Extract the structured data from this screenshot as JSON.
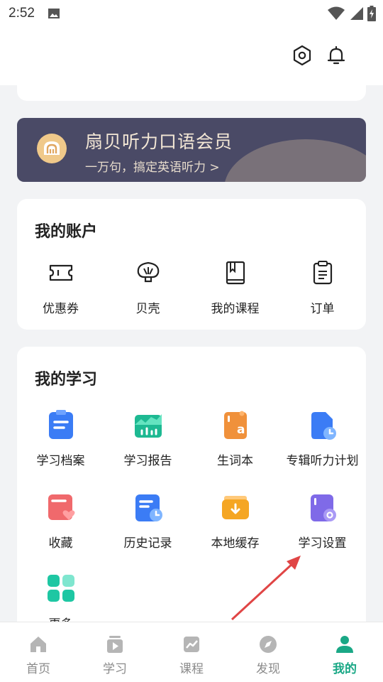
{
  "status_bar": {
    "time": "2:52"
  },
  "banner": {
    "title": "扇贝听力口语会员",
    "subtitle": "一万句，搞定英语听力 >"
  },
  "account": {
    "title": "我的账户",
    "items": [
      {
        "label": "优惠券",
        "icon": "coupon-icon"
      },
      {
        "label": "贝壳",
        "icon": "shell-icon"
      },
      {
        "label": "我的课程",
        "icon": "book-icon"
      },
      {
        "label": "订单",
        "icon": "order-icon"
      }
    ]
  },
  "study": {
    "title": "我的学习",
    "items": [
      {
        "label": "学习档案",
        "icon": "archive-icon"
      },
      {
        "label": "学习报告",
        "icon": "report-icon"
      },
      {
        "label": "生词本",
        "icon": "vocabulary-icon"
      },
      {
        "label": "专辑听力计划",
        "icon": "album-plan-icon"
      },
      {
        "label": "收藏",
        "icon": "favorites-icon"
      },
      {
        "label": "历史记录",
        "icon": "history-icon"
      },
      {
        "label": "本地缓存",
        "icon": "cache-icon"
      },
      {
        "label": "学习设置",
        "icon": "study-settings-icon"
      },
      {
        "label": "更多",
        "icon": "more-icon"
      }
    ]
  },
  "tabs": [
    {
      "label": "首页",
      "icon": "home-icon"
    },
    {
      "label": "学习",
      "icon": "play-icon"
    },
    {
      "label": "课程",
      "icon": "course-icon"
    },
    {
      "label": "发现",
      "icon": "compass-icon"
    },
    {
      "label": "我的",
      "icon": "profile-icon"
    }
  ],
  "colors": {
    "accent": "#1aa886",
    "banner_bg": "#4a4a66",
    "annotation": "#e04545"
  }
}
